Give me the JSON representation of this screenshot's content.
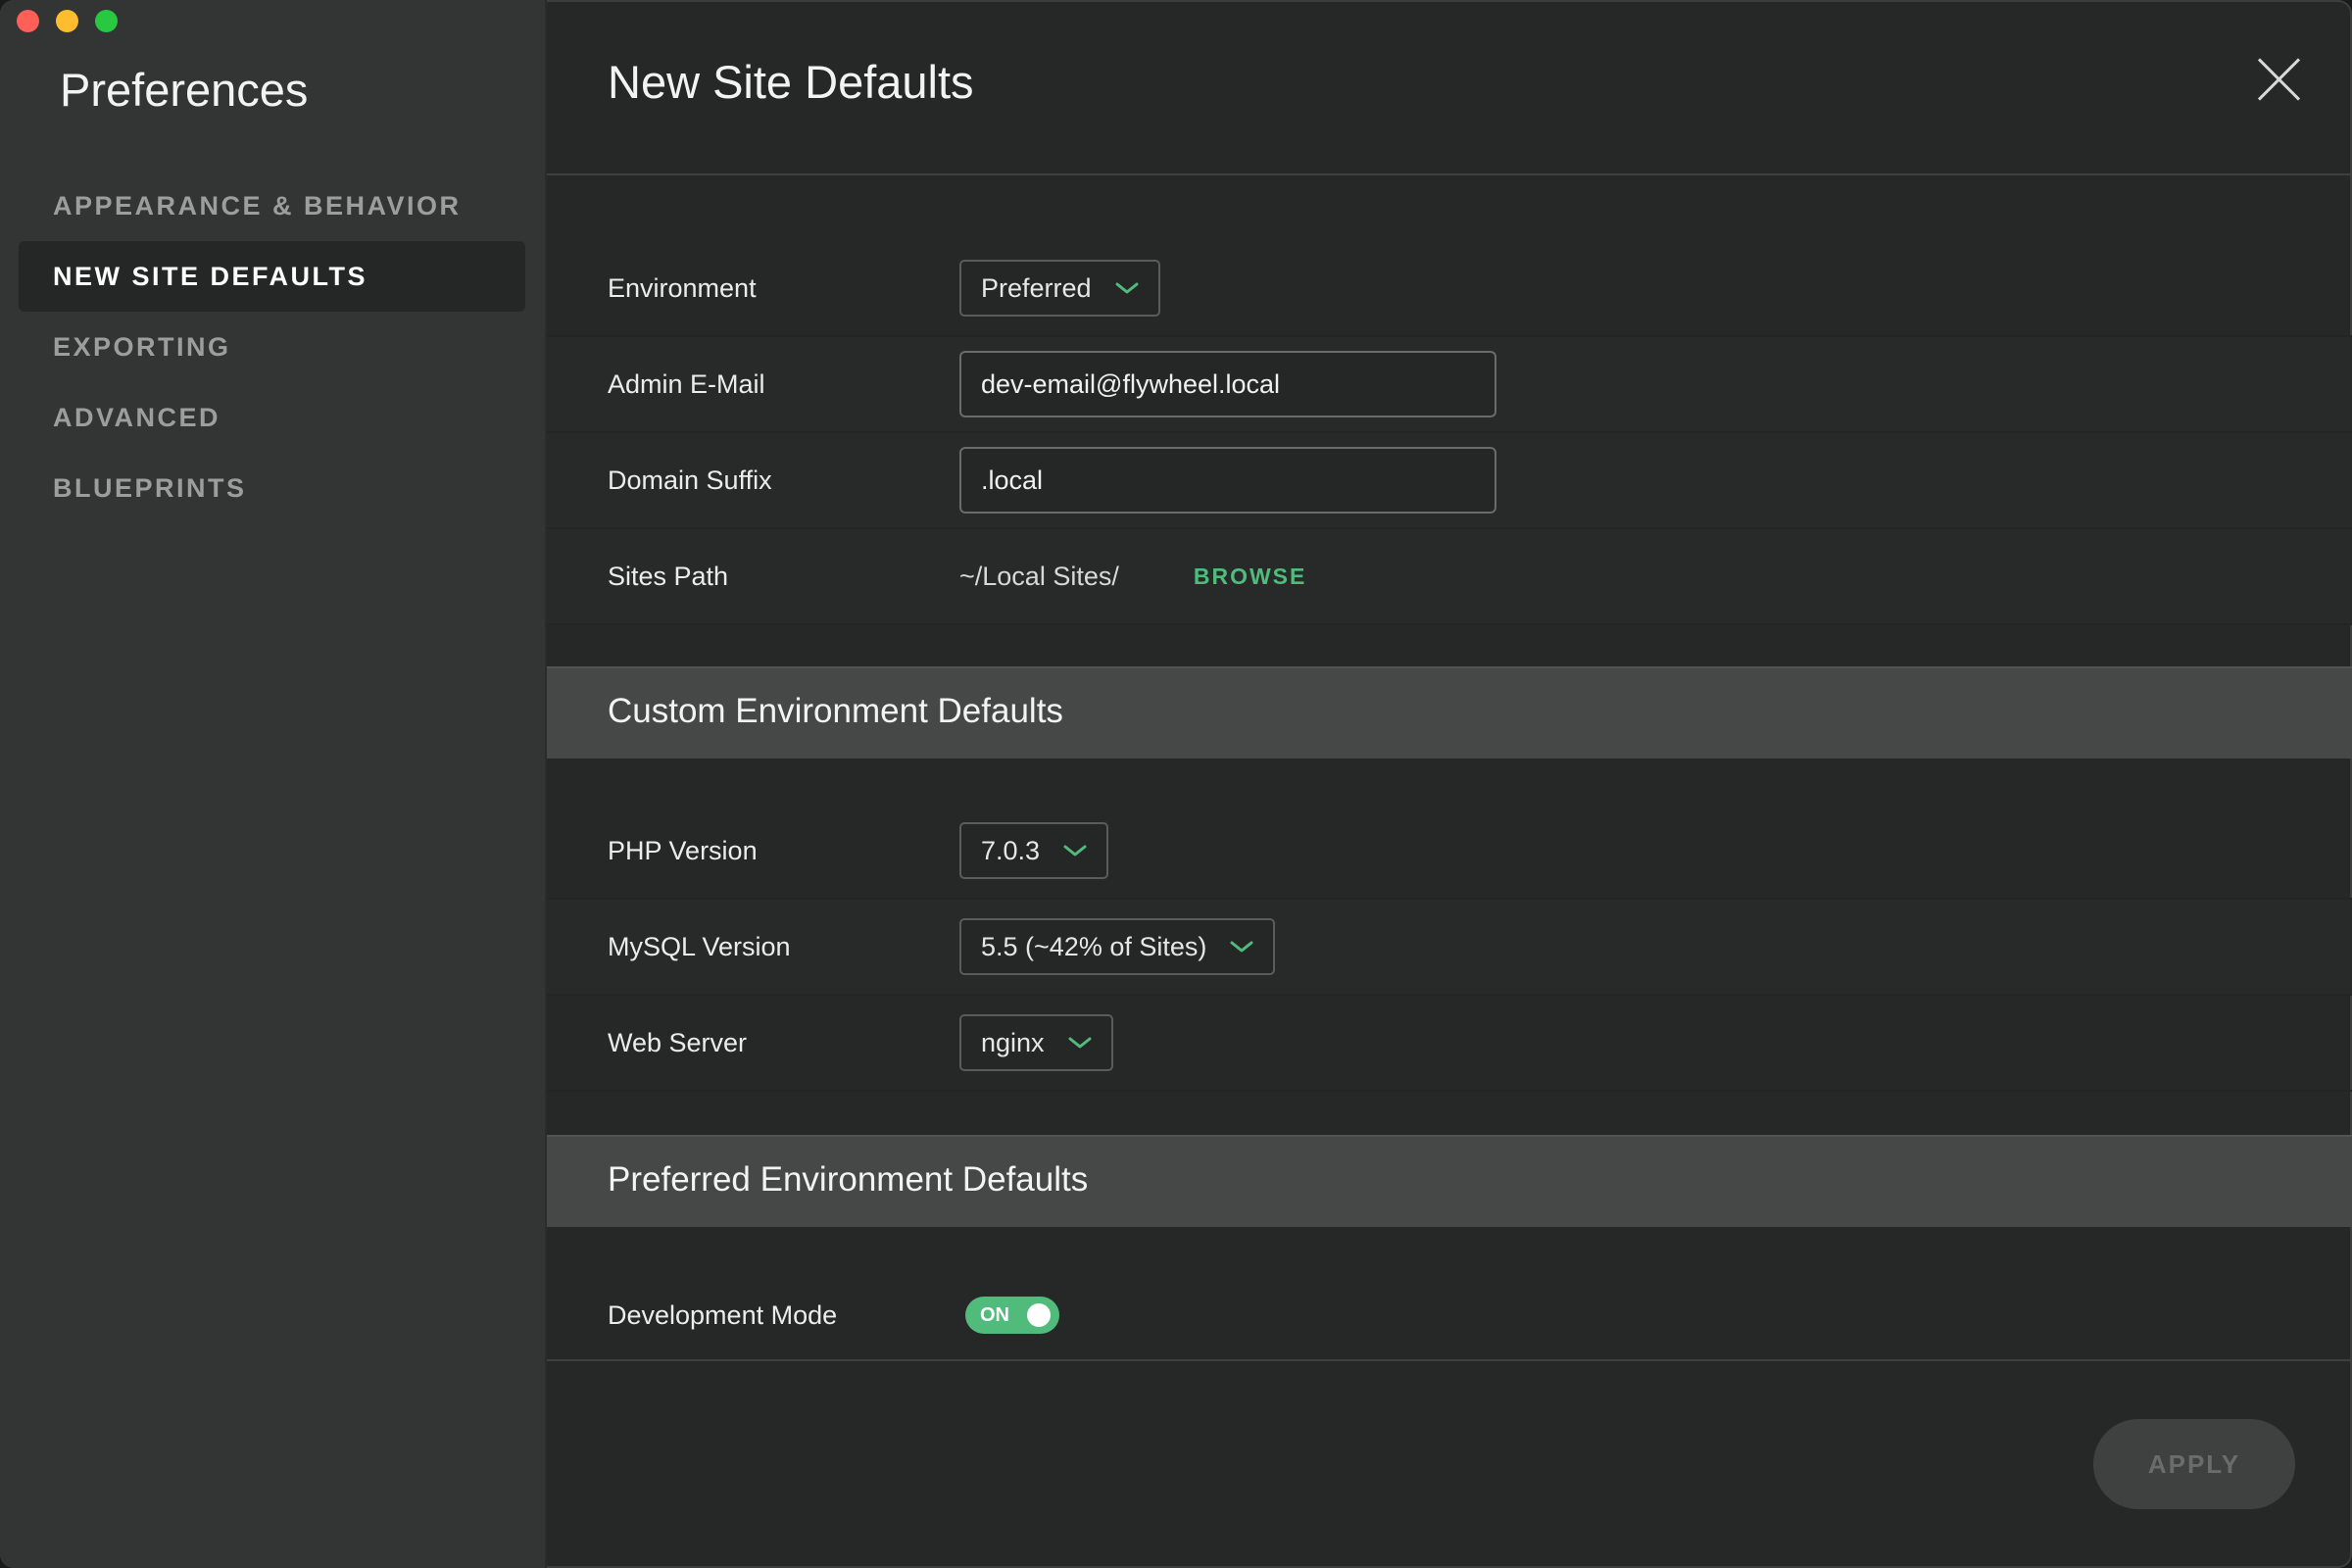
{
  "sidebar": {
    "title": "Preferences",
    "items": [
      {
        "label": "APPEARANCE & BEHAVIOR"
      },
      {
        "label": "NEW SITE DEFAULTS"
      },
      {
        "label": "EXPORTING"
      },
      {
        "label": "ADVANCED"
      },
      {
        "label": "BLUEPRINTS"
      }
    ],
    "active_index": 1
  },
  "main": {
    "title": "New Site Defaults",
    "general": {
      "environment": {
        "label": "Environment",
        "value": "Preferred"
      },
      "admin_email": {
        "label": "Admin E-Mail",
        "value": "dev-email@flywheel.local"
      },
      "domain_suffix": {
        "label": "Domain Suffix",
        "value": ".local"
      },
      "sites_path": {
        "label": "Sites Path",
        "value": "~/Local Sites/",
        "browse_label": "BROWSE"
      }
    },
    "custom_section": {
      "title": "Custom Environment Defaults",
      "php": {
        "label": "PHP Version",
        "value": "7.0.3"
      },
      "mysql": {
        "label": "MySQL Version",
        "value": "5.5 (~42% of Sites)"
      },
      "web_server": {
        "label": "Web Server",
        "value": "nginx"
      }
    },
    "preferred_section": {
      "title": "Preferred Environment Defaults",
      "dev_mode": {
        "label": "Development Mode",
        "toggle_text": "ON",
        "state": "on"
      }
    },
    "apply_label": "APPLY"
  },
  "colors": {
    "accent_green": "#51bb7b",
    "sidebar_bg": "#333535",
    "main_bg": "#262828",
    "section_bg": "#464848"
  },
  "icons": {
    "close": "close-icon",
    "chevron": "chevron-down-icon"
  }
}
